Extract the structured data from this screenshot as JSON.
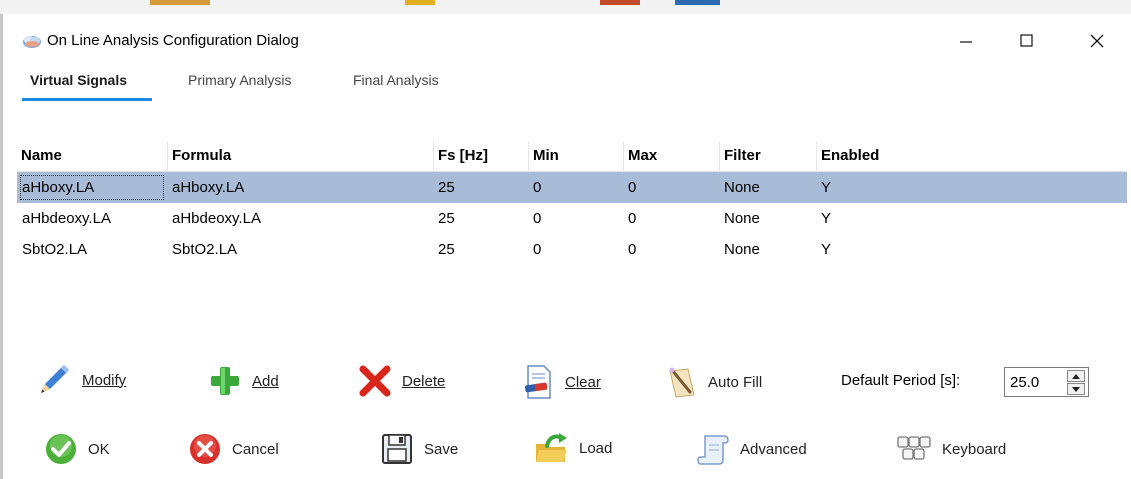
{
  "window": {
    "title": "On Line Analysis Configuration Dialog",
    "minimize_glyph": "—",
    "maximize_glyph": "☐",
    "close_glyph": "✕"
  },
  "tabs": [
    {
      "label": "Virtual Signals",
      "active": true
    },
    {
      "label": "Primary Analysis",
      "active": false
    },
    {
      "label": "Final Analysis",
      "active": false
    }
  ],
  "table": {
    "columns": [
      "Name",
      "Formula",
      "Fs [Hz]",
      "Min",
      "Max",
      "Filter",
      "Enabled"
    ],
    "rows": [
      [
        "aHboxy.LA",
        "aHboxy.LA",
        "25",
        "0",
        "0",
        "None",
        "Y"
      ],
      [
        "aHbdeoxy.LA",
        "aHbdeoxy.LA",
        "25",
        "0",
        "0",
        "None",
        "Y"
      ],
      [
        "SbtO2.LA",
        "SbtO2.LA",
        "25",
        "0",
        "0",
        "None",
        "Y"
      ]
    ],
    "selected_row": 0,
    "selected_color": "#a8bbd7"
  },
  "toolbar1": {
    "modify": "Modify",
    "add": "Add",
    "delete": "Delete",
    "clear": "Clear",
    "auto_fill": "Auto Fill"
  },
  "period": {
    "label": "Default Period [s]:",
    "value": "25.0"
  },
  "toolbar2": {
    "ok": "OK",
    "cancel": "Cancel",
    "save": "Save",
    "load": "Load",
    "advanced": "Advanced",
    "keyboard": "Keyboard"
  },
  "icons": {
    "app": "clouds-icon",
    "modify": "pencil-icon",
    "add": "plus-icon",
    "delete": "red-x-icon",
    "clear": "document-eraser-icon",
    "auto_fill": "magic-wand-icon",
    "ok": "green-check-icon",
    "cancel": "red-circle-x-icon",
    "save": "floppy-disk-icon",
    "load": "folder-arrow-icon",
    "advanced": "scroll-icon",
    "keyboard": "keyboard-keys-icon"
  },
  "colors": {
    "tab_underline": "#1e88e5",
    "row_selected": "#a8bbd7"
  }
}
